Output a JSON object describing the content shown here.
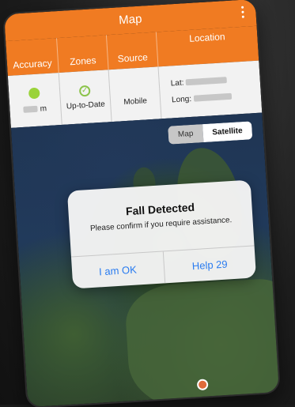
{
  "app": {
    "title": "Map"
  },
  "table": {
    "headers": [
      "Accuracy",
      "Zones",
      "Source",
      "Location"
    ],
    "accuracy_unit": "m",
    "zones_status": "Up-to-Date",
    "source_value": "Mobile",
    "lat_label": "Lat:",
    "long_label": "Long:"
  },
  "map": {
    "toggle_map": "Map",
    "toggle_satellite": "Satellite",
    "selected": "Satellite"
  },
  "alert": {
    "title": "Fall Detected",
    "message": "Please confirm if you require assistance.",
    "ok_label": "I am OK",
    "help_label": "Help 29"
  },
  "colors": {
    "accent": "#f07b22",
    "status_ok": "#9ad33a",
    "link": "#2a7cf0"
  },
  "icons": [
    "menu-dots-icon",
    "accuracy-dot-icon",
    "check-circle-icon",
    "location-pin-icon"
  ]
}
